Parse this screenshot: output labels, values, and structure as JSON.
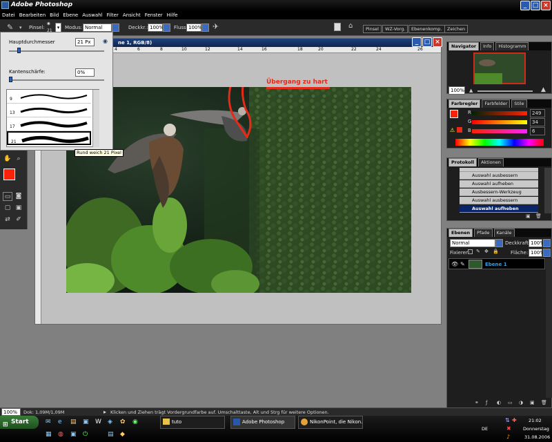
{
  "app": {
    "title": "Adobe Photoshop",
    "menu": [
      "Datei",
      "Bearbeiten",
      "Bild",
      "Ebene",
      "Auswahl",
      "Filter",
      "Ansicht",
      "Fenster",
      "Hilfe"
    ]
  },
  "options_bar": {
    "pinsel_label": "Pinsel:",
    "pinsel_size": "21",
    "modus_label": "Modus:",
    "modus_value": "Normal",
    "deckkr_label": "Deckkr.:",
    "deckkr_value": "100%",
    "fluss_label": "Fluss:",
    "fluss_value": "100%",
    "palette_tabs": [
      "Pinsel",
      "WZ-Vorg.",
      "Ebenenkomp.",
      "Zeichen"
    ]
  },
  "brush_picker": {
    "hauptdurchmesser_label": "Hauptdurchmesser",
    "hauptdurchmesser_value": "21 Px",
    "kantenschaerfe_label": "Kantenschärfe:",
    "kantenschaerfe_value": "0%",
    "brush_sizes": [
      "9",
      "13",
      "17",
      "21"
    ],
    "tooltip": "Rund weich 21 Pixel"
  },
  "document": {
    "title_fragment": "ne 1, RGB/8)",
    "ruler_labels": [
      "4",
      "6",
      "8",
      "10",
      "12",
      "14",
      "16",
      "18",
      "20",
      "22",
      "24",
      "26"
    ],
    "annotation": "Übergang zu hart"
  },
  "navigator": {
    "tabs": [
      "Navigator",
      "Info",
      "Histogramm"
    ],
    "zoom": "100%"
  },
  "color_panel": {
    "tabs": [
      "Farbregler",
      "Farbfelder",
      "Stile"
    ],
    "r_label": "R",
    "r_value": "249",
    "g_label": "G",
    "g_value": "34",
    "b_label": "B",
    "b_value": "6",
    "foreground": "#f92206"
  },
  "history_panel": {
    "tabs": [
      "Protokoll",
      "Aktionen"
    ],
    "items": [
      "Auswahl ausbessern",
      "Auswahl aufheben",
      "Ausbessern-Werkzeug",
      "Auswahl ausbessern",
      "Auswahl aufheben"
    ]
  },
  "layers_panel": {
    "tabs": [
      "Ebenen",
      "Pfade",
      "Kanäle"
    ],
    "blend_mode": "Normal",
    "deckkraft_label": "Deckkraft:",
    "deckkraft_value": "100%",
    "fixieren_label": "Fixieren:",
    "flaeche_label": "Fläche:",
    "flaeche_value": "100%",
    "layer_name": "Ebene 1"
  },
  "status_bar": {
    "zoom": "100%",
    "doc_info": "Dok: 1,09M/1,09M",
    "hint": "Klicken und Ziehen trägt Vordergrundfarbe auf. Umschalttaste, Alt und Strg für weitere Optionen."
  },
  "taskbar": {
    "start": "Start",
    "tasks": [
      "tuto",
      "Adobe Photoshop",
      "NikonPoint, die Nikon..."
    ],
    "lang": "DE",
    "time": "21:02",
    "day": "Donnerstag",
    "date": "31.08.2006"
  }
}
